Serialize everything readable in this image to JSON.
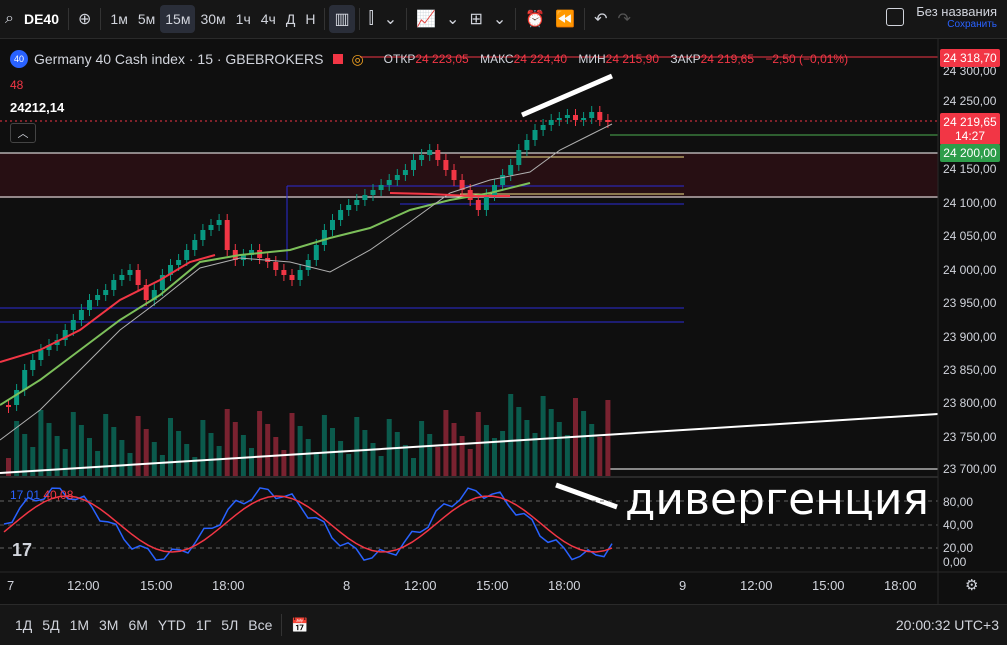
{
  "toolbar": {
    "search_icon": "search-icon",
    "symbol": "DE40",
    "add_icon": "plus-circle-icon",
    "intervals": [
      "1м",
      "5м",
      "15м",
      "30м",
      "1ч",
      "4ч",
      "Д",
      "Н"
    ],
    "active_interval": "15м",
    "title": "Без названия",
    "save_hint": "Сохранить"
  },
  "legend": {
    "logo_text": "40",
    "name": "Germany 40 Cash index · 15 · GBEBROKERS",
    "open_label": "ОТКР",
    "open": "24 223,05",
    "high_label": "МАКС",
    "high": "24 224,40",
    "low_label": "МИН",
    "low": "24 215,90",
    "close_label": "ЗАКР",
    "close": "24 219,65",
    "change": "−2,50 (−0,01%)",
    "indicator1": "48",
    "indicator2": "24212,14"
  },
  "price_axis": {
    "labels": [
      "24 300,00",
      "24 250,00",
      "24 150,00",
      "24 100,00",
      "24 050,00",
      "24 000,00",
      "23 950,00",
      "23 900,00",
      "23 850,00",
      "23 800,00",
      "23 750,00",
      "23 700,00"
    ],
    "tag_top": "24 318,70",
    "tag_current": "24 219,65",
    "tag_countdown": "14:27",
    "tag_level": "24 200,00"
  },
  "stoch": {
    "k": "17,01",
    "d": "40,08",
    "axis": [
      "80,00",
      "40,00",
      "20,00",
      "0,00"
    ]
  },
  "time_axis": [
    "7",
    "12:00",
    "15:00",
    "18:00",
    "8",
    "12:00",
    "15:00",
    "18:00",
    "9",
    "12:00",
    "15:00",
    "18:00"
  ],
  "annotation": "дивергенция",
  "bottom": {
    "ranges": [
      "1Д",
      "5Д",
      "1М",
      "3М",
      "6М",
      "YTD",
      "1Г",
      "5Л",
      "Все"
    ],
    "clock": "20:00:32 UTC+3"
  },
  "colors": {
    "up": "#089981",
    "down": "#f23645",
    "bg": "#0f0f0f"
  }
}
